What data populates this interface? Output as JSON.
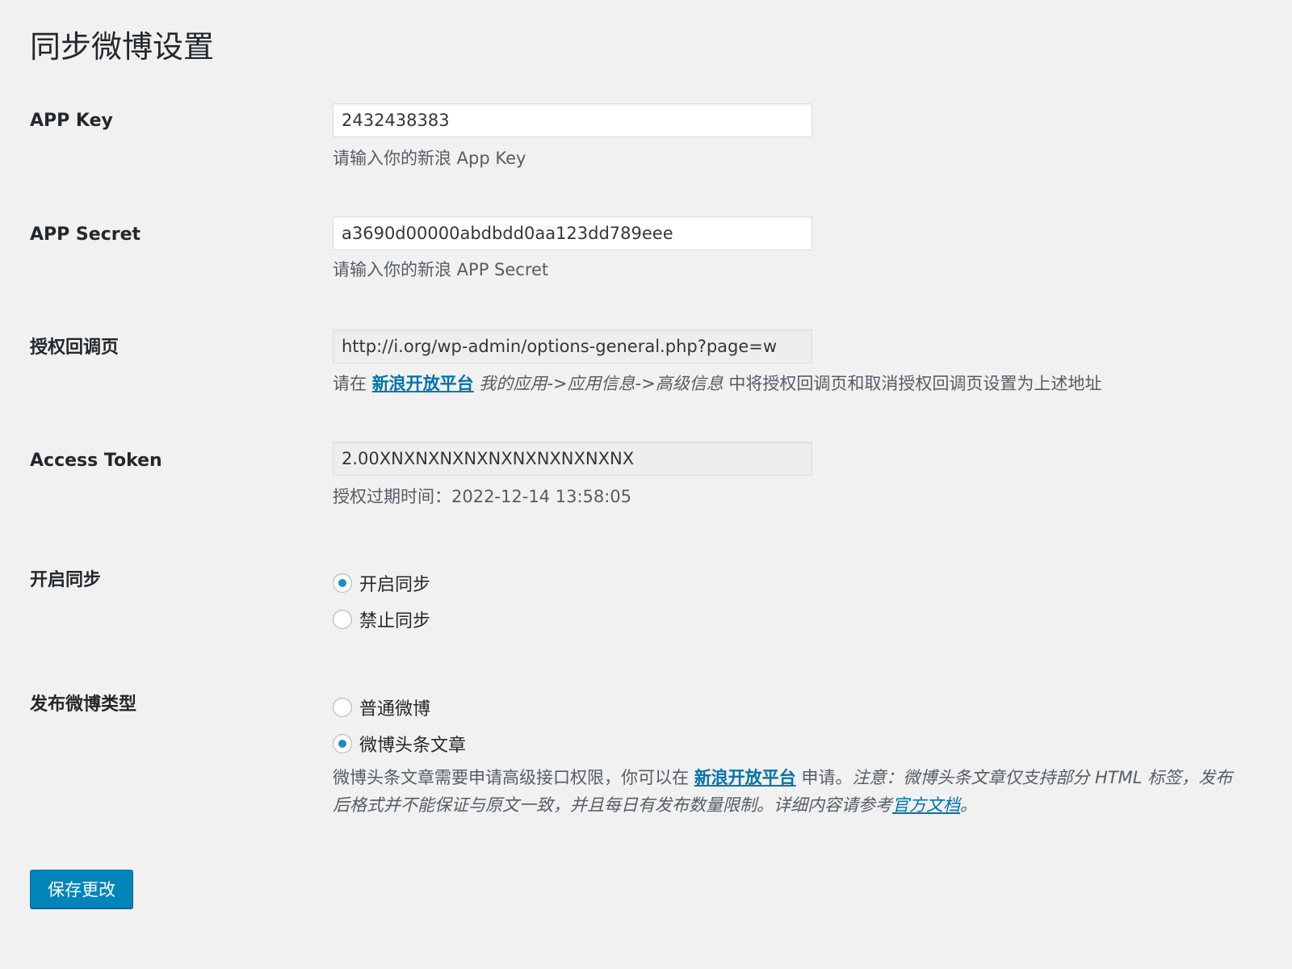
{
  "page": {
    "title": "同步微博设置"
  },
  "fields": {
    "app_key": {
      "label": "APP Key",
      "value": "2432438383",
      "description": "请输入你的新浪 App Key"
    },
    "app_secret": {
      "label": "APP Secret",
      "value": "a3690d00000abdbdd0aa123dd789eee",
      "description": "请输入你的新浪 APP Secret"
    },
    "callback": {
      "label": "授权回调页",
      "value": "http://i.org/wp-admin/options-general.php?page=w",
      "desc_prefix": "请在 ",
      "desc_link": "新浪开放平台",
      "desc_path": "我的应用->应用信息->高级信息",
      "desc_suffix": " 中将授权回调页和取消授权回调页设置为上述地址"
    },
    "access_token": {
      "label": "Access Token",
      "value": "2.00XNXNXNXNXNXNXNXNXNXNX",
      "description": "授权过期时间：2022-12-14 13:58:05"
    }
  },
  "sync": {
    "label": "开启同步",
    "options": [
      {
        "label": "开启同步",
        "checked": true
      },
      {
        "label": "禁止同步",
        "checked": false
      }
    ]
  },
  "publish_type": {
    "label": "发布微博类型",
    "options": [
      {
        "label": "普通微博",
        "checked": false
      },
      {
        "label": "微博头条文章",
        "checked": true
      }
    ],
    "note_prefix": "微博头条文章需要申请高级接口权限，你可以在 ",
    "note_link": "新浪开放平台",
    "note_mid": " 申请。",
    "note_italic": "注意：微博头条文章仅支持部分 HTML 标签，发布后格式并不能保证与原文一致，并且每日有发布数量限制。详细内容请参考",
    "note_doc_link": "官方文档",
    "note_end": "。"
  },
  "actions": {
    "save_label": "保存更改"
  },
  "colors": {
    "accent": "#0085ba",
    "link": "#0073aa",
    "background": "#f1f1f1"
  }
}
